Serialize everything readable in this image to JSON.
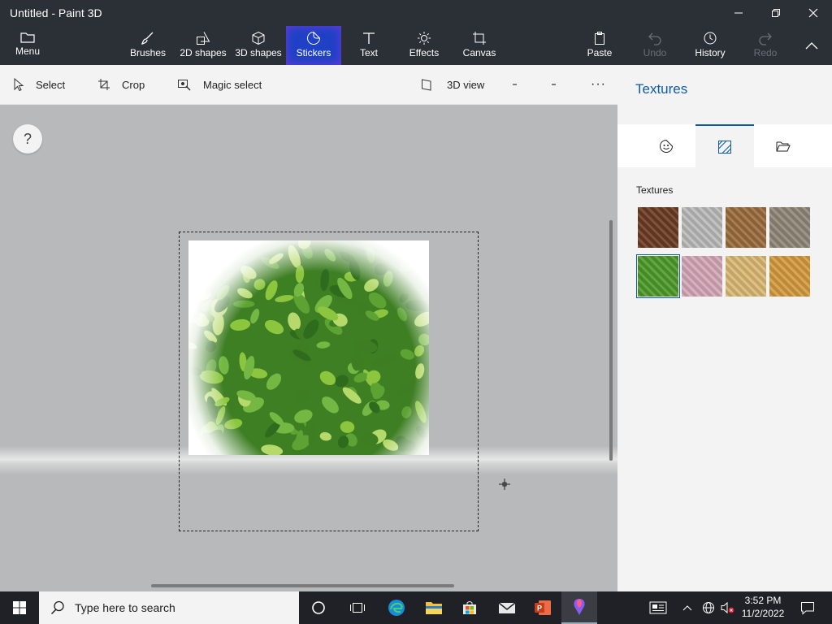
{
  "window": {
    "title": "Untitled - Paint 3D",
    "controls": [
      "minimize-icon",
      "restore-icon",
      "close-icon"
    ]
  },
  "ribbon": {
    "menu_label": "Menu",
    "tools": [
      {
        "label": "Brushes",
        "icon": "brush-icon"
      },
      {
        "label": "2D shapes",
        "icon": "2d-shapes-icon"
      },
      {
        "label": "3D shapes",
        "icon": "3d-shapes-icon"
      },
      {
        "label": "Stickers",
        "icon": "stickers-icon",
        "active": true
      },
      {
        "label": "Text",
        "icon": "text-icon"
      },
      {
        "label": "Effects",
        "icon": "effects-icon"
      },
      {
        "label": "Canvas",
        "icon": "canvas-icon"
      }
    ],
    "actions": [
      {
        "label": "Paste",
        "icon": "paste-icon"
      },
      {
        "label": "Undo",
        "icon": "undo-icon",
        "disabled": true
      },
      {
        "label": "History",
        "icon": "history-icon"
      },
      {
        "label": "Redo",
        "icon": "redo-icon",
        "disabled": true
      }
    ]
  },
  "toolbar": {
    "select_label": "Select",
    "crop_label": "Crop",
    "magic_select_label": "Magic select",
    "view3d_label": "3D view",
    "more_label": "···"
  },
  "canvas": {
    "help_label": "?"
  },
  "panel": {
    "title": "Textures",
    "section_label": "Textures",
    "tabs": [
      "stickers-tab-icon",
      "textures-tab-icon",
      "custom-stickers-tab-icon"
    ],
    "swatches": [
      {
        "name": "bark-texture",
        "color": "#6b3b22"
      },
      {
        "name": "granite-texture",
        "color": "#b9b9b9"
      },
      {
        "name": "wood-grain-texture",
        "color": "#9a6b3d"
      },
      {
        "name": "pebbles-texture",
        "color": "#8f8676"
      },
      {
        "name": "leaves-texture",
        "color": "#4c9a2a",
        "selected": true
      },
      {
        "name": "pink-marble-texture",
        "color": "#d3a6b6"
      },
      {
        "name": "sand-texture",
        "color": "#d9b873"
      },
      {
        "name": "light-wood-texture",
        "color": "#d49a3e"
      }
    ]
  },
  "taskbar": {
    "search_placeholder": "Type here to search",
    "time": "3:52 PM",
    "date": "11/2/2022"
  },
  "colors": {
    "accent": "#0f5aa6",
    "titlebar": "#2b2f36",
    "active_tool": "#1f41c6"
  }
}
